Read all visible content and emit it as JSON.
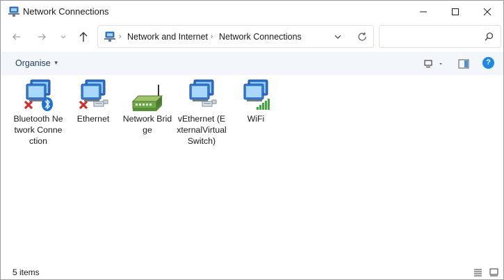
{
  "window": {
    "title": "Network Connections"
  },
  "address_bar": {
    "crumbs": [
      "Network and Internet",
      "Network Connections"
    ],
    "search_placeholder": ""
  },
  "command_bar": {
    "organise_label": "Organise"
  },
  "items": [
    {
      "label": "Bluetooth Network Connection",
      "icon": "bluetooth-network-icon",
      "status": "disconnected"
    },
    {
      "label": "Ethernet",
      "icon": "ethernet-network-icon",
      "status": "disconnected"
    },
    {
      "label": "Network Bridge",
      "icon": "network-bridge-icon",
      "status": "normal"
    },
    {
      "label": "vEthernet (ExternalVirtualSwitch)",
      "icon": "vethernet-network-icon",
      "status": "connected"
    },
    {
      "label": "WiFi",
      "icon": "wifi-network-icon",
      "status": "connected"
    }
  ],
  "status_bar": {
    "item_count": "5 items"
  },
  "colors": {
    "command_bar_bg": "#f3f6fb",
    "accent": "#1e88e5",
    "error": "#d32f2f"
  }
}
